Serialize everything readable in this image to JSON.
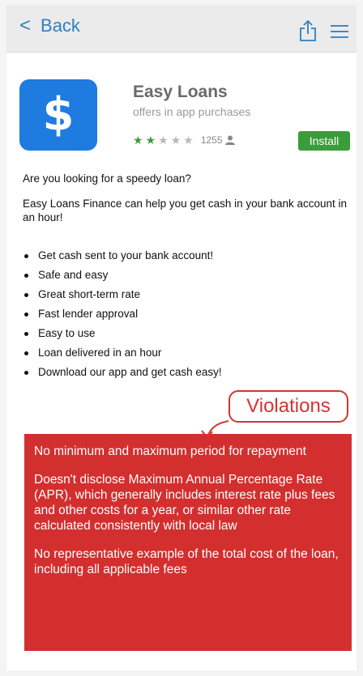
{
  "header": {
    "back_label": "Back"
  },
  "app": {
    "name": "Easy Loans",
    "subtitle": "offers in app purchases",
    "rating": {
      "filled": 2,
      "total": 5,
      "count": "1255"
    },
    "install_label": "Install",
    "colors": {
      "icon_bg": "#1e7be0",
      "install_bg": "#3a9c3a",
      "star_filled": "#3a9c3a",
      "star_empty": "#b8b8b8"
    }
  },
  "description": {
    "question": "Are you looking for a speedy loan?",
    "intro": "Easy Loans Finance can help you get cash in your bank account in an hour!",
    "bullets": [
      "Get cash sent to your bank account!",
      "Safe and easy",
      "Great short-term rate",
      "Fast lender approval",
      "Easy to use",
      "Loan delivered in an hour",
      "Download our app and get cash easy!"
    ]
  },
  "annotation": {
    "label": "Violations",
    "color": "#d32f2f",
    "items": [
      "No minimum and maximum period for repayment",
      "Doesn't disclose Maximum Annual Percentage Rate (APR), which generally includes interest rate plus fees and other costs for a year, or similar other rate calculated consistently with local law",
      "No representative example of the total cost of the loan, including all applicable fees"
    ]
  }
}
